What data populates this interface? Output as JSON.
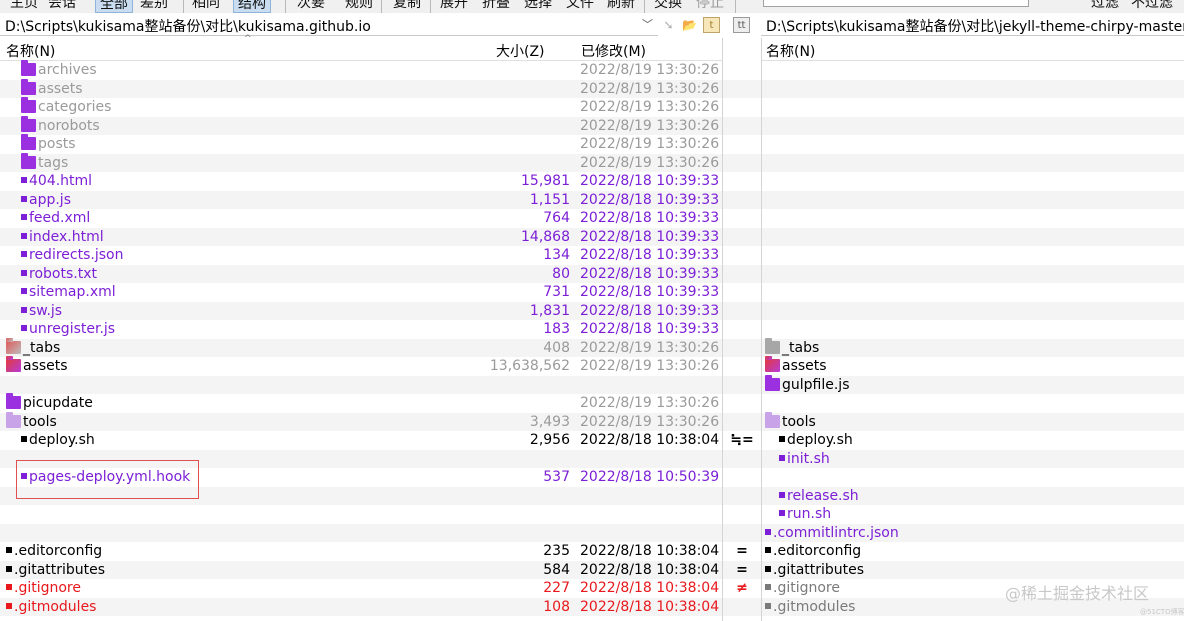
{
  "toolbar": {
    "items": [
      {
        "label": "主页",
        "state": "normal"
      },
      {
        "label": "会话",
        "state": "normal"
      },
      {
        "label": "全部",
        "state": "active"
      },
      {
        "label": "差别",
        "state": "normal"
      },
      {
        "label": "相同",
        "state": "normal"
      },
      {
        "label": "结构",
        "state": "active"
      },
      {
        "label": "次要",
        "state": "normal"
      },
      {
        "label": "规则",
        "state": "normal"
      },
      {
        "label": "复制",
        "state": "normal"
      },
      {
        "label": "展开",
        "state": "normal"
      },
      {
        "label": "折叠",
        "state": "normal"
      },
      {
        "label": "选择",
        "state": "normal"
      },
      {
        "label": "文件",
        "state": "normal"
      },
      {
        "label": "刷新",
        "state": "normal"
      },
      {
        "label": "交换",
        "state": "normal"
      },
      {
        "label": "停止",
        "state": "disabled"
      },
      {
        "label": "过滤",
        "state": "normal"
      },
      {
        "label": "不过滤",
        "state": "normal"
      }
    ]
  },
  "left_pane": {
    "path": "D:\\Scripts\\kukisama整站备份\\对比\\kukisama.github.io",
    "columns": {
      "name": "名称(N)",
      "size": "大小(Z)",
      "modified": "已修改(M)"
    }
  },
  "right_pane": {
    "path": "D:\\Scripts\\kukisama整站备份\\对比\\jekyll-theme-chirpy-master\\to",
    "columns": {
      "name": "名称(N)"
    }
  },
  "rows": [
    {
      "l_name": "archives",
      "l_icon": "folder-purple",
      "l_color": "gray",
      "l_indent": 1,
      "l_size": "",
      "l_date": "2022/8/19 13:30:26",
      "mid": "",
      "r_name": "",
      "r_icon": "",
      "r_color": ""
    },
    {
      "l_name": "assets",
      "l_icon": "folder-purple",
      "l_color": "gray",
      "l_indent": 1,
      "l_size": "",
      "l_date": "2022/8/19 13:30:26",
      "mid": "",
      "r_name": "",
      "r_icon": "",
      "r_color": ""
    },
    {
      "l_name": "categories",
      "l_icon": "folder-purple",
      "l_color": "gray",
      "l_indent": 1,
      "l_size": "",
      "l_date": "2022/8/19 13:30:26",
      "mid": "",
      "r_name": "",
      "r_icon": "",
      "r_color": ""
    },
    {
      "l_name": "norobots",
      "l_icon": "folder-purple",
      "l_color": "gray",
      "l_indent": 1,
      "l_size": "",
      "l_date": "2022/8/19 13:30:26",
      "mid": "",
      "r_name": "",
      "r_icon": "",
      "r_color": ""
    },
    {
      "l_name": "posts",
      "l_icon": "folder-purple",
      "l_color": "gray",
      "l_indent": 1,
      "l_size": "",
      "l_date": "2022/8/19 13:30:26",
      "mid": "",
      "r_name": "",
      "r_icon": "",
      "r_color": ""
    },
    {
      "l_name": "tags",
      "l_icon": "folder-purple",
      "l_color": "gray",
      "l_indent": 1,
      "l_size": "",
      "l_date": "2022/8/19 13:30:26",
      "mid": "",
      "r_name": "",
      "r_icon": "",
      "r_color": ""
    },
    {
      "l_name": "404.html",
      "l_icon": "file-purple",
      "l_color": "purple",
      "l_indent": 1,
      "l_size": "15,981",
      "l_date": "2022/8/18 10:39:33",
      "mid": "",
      "r_name": "",
      "r_icon": "",
      "r_color": ""
    },
    {
      "l_name": "app.js",
      "l_icon": "file-purple",
      "l_color": "purple",
      "l_indent": 1,
      "l_size": "1,151",
      "l_date": "2022/8/18 10:39:33",
      "mid": "",
      "r_name": "",
      "r_icon": "",
      "r_color": ""
    },
    {
      "l_name": "feed.xml",
      "l_icon": "file-purple",
      "l_color": "purple",
      "l_indent": 1,
      "l_size": "764",
      "l_date": "2022/8/18 10:39:33",
      "mid": "",
      "r_name": "",
      "r_icon": "",
      "r_color": ""
    },
    {
      "l_name": "index.html",
      "l_icon": "file-purple",
      "l_color": "purple",
      "l_indent": 1,
      "l_size": "14,868",
      "l_date": "2022/8/18 10:39:33",
      "mid": "",
      "r_name": "",
      "r_icon": "",
      "r_color": ""
    },
    {
      "l_name": "redirects.json",
      "l_icon": "file-purple",
      "l_color": "purple",
      "l_indent": 1,
      "l_size": "134",
      "l_date": "2022/8/18 10:39:33",
      "mid": "",
      "r_name": "",
      "r_icon": "",
      "r_color": ""
    },
    {
      "l_name": "robots.txt",
      "l_icon": "file-purple",
      "l_color": "purple",
      "l_indent": 1,
      "l_size": "80",
      "l_date": "2022/8/18 10:39:33",
      "mid": "",
      "r_name": "",
      "r_icon": "",
      "r_color": ""
    },
    {
      "l_name": "sitemap.xml",
      "l_icon": "file-purple",
      "l_color": "purple",
      "l_indent": 1,
      "l_size": "731",
      "l_date": "2022/8/18 10:39:33",
      "mid": "",
      "r_name": "",
      "r_icon": "",
      "r_color": ""
    },
    {
      "l_name": "sw.js",
      "l_icon": "file-purple",
      "l_color": "purple",
      "l_indent": 1,
      "l_size": "1,831",
      "l_date": "2022/8/18 10:39:33",
      "mid": "",
      "r_name": "",
      "r_icon": "",
      "r_color": ""
    },
    {
      "l_name": "unregister.js",
      "l_icon": "file-purple",
      "l_color": "purple",
      "l_indent": 1,
      "l_size": "183",
      "l_date": "2022/8/18 10:39:33",
      "mid": "",
      "r_name": "",
      "r_icon": "",
      "r_color": ""
    },
    {
      "l_name": "_tabs",
      "l_icon": "folder-redgray",
      "l_color": "black",
      "l_indent": 0,
      "l_size": "408",
      "l_size_gray": true,
      "l_date": "2022/8/19 13:30:26",
      "l_date_gray": true,
      "mid": "",
      "r_name": "_tabs",
      "r_icon": "folder-gray",
      "r_color": "black"
    },
    {
      "l_name": "assets",
      "l_icon": "folder-redpurple",
      "l_color": "black",
      "l_indent": 0,
      "l_size": "13,638,562",
      "l_size_gray": true,
      "l_date": "2022/8/19 13:30:26",
      "l_date_gray": true,
      "mid": "",
      "r_name": "assets",
      "r_icon": "folder-redpurple",
      "r_color": "black"
    },
    {
      "l_name": "",
      "l_icon": "",
      "l_color": "",
      "l_indent": 0,
      "l_size": "",
      "l_date": "",
      "mid": "",
      "r_name": "gulpfile.js",
      "r_icon": "folder-purple",
      "r_color": "black"
    },
    {
      "l_name": "picupdate",
      "l_icon": "folder-purple",
      "l_color": "black",
      "l_indent": 0,
      "l_size": "",
      "l_date": "2022/8/19 13:30:26",
      "l_date_gray": true,
      "mid": "",
      "r_name": "",
      "r_icon": "",
      "r_color": ""
    },
    {
      "l_name": "tools",
      "l_icon": "folder-pink",
      "l_color": "black",
      "l_indent": 0,
      "l_size": "3,493",
      "l_size_gray": true,
      "l_date": "2022/8/19 13:30:26",
      "l_date_gray": true,
      "mid": "",
      "r_name": "tools",
      "r_icon": "folder-pink",
      "r_color": "black"
    },
    {
      "l_name": "deploy.sh",
      "l_icon": "file-black",
      "l_color": "black",
      "l_indent": 1,
      "l_size": "2,956",
      "l_date": "2022/8/18 10:38:04",
      "mid": "≒=",
      "r_name": "deploy.sh",
      "r_icon": "file-black",
      "r_color": "black",
      "r_indent": 1
    },
    {
      "l_name": "",
      "l_icon": "",
      "l_color": "",
      "l_indent": 0,
      "l_size": "",
      "l_date": "",
      "mid": "",
      "r_name": "init.sh",
      "r_icon": "file-purple",
      "r_color": "purple",
      "r_indent": 1,
      "r_selected": true
    },
    {
      "l_name": "pages-deploy.yml.hook",
      "l_icon": "file-purple",
      "l_color": "purple",
      "l_indent": 1,
      "l_size": "537",
      "l_date": "2022/8/18 10:50:39",
      "mid": "",
      "r_name": "",
      "r_icon": "",
      "r_color": ""
    },
    {
      "l_name": "",
      "l_icon": "",
      "l_color": "",
      "l_indent": 0,
      "l_size": "",
      "l_date": "",
      "mid": "",
      "r_name": "release.sh",
      "r_icon": "file-purple",
      "r_color": "purple",
      "r_indent": 1
    },
    {
      "l_name": "",
      "l_icon": "",
      "l_color": "",
      "l_indent": 0,
      "l_size": "",
      "l_date": "",
      "mid": "",
      "r_name": "run.sh",
      "r_icon": "file-purple",
      "r_color": "purple",
      "r_indent": 1
    },
    {
      "l_name": "",
      "l_icon": "",
      "l_color": "",
      "l_indent": 0,
      "l_size": "",
      "l_date": "",
      "mid": "",
      "r_name": ".commitlintrc.json",
      "r_icon": "file-purple",
      "r_color": "purple",
      "r_indent": 0
    },
    {
      "l_name": ".editorconfig",
      "l_icon": "file-black",
      "l_color": "black",
      "l_indent": 0,
      "l_size": "235",
      "l_date": "2022/8/18 10:38:04",
      "mid": "=",
      "r_name": ".editorconfig",
      "r_icon": "file-black",
      "r_color": "black"
    },
    {
      "l_name": ".gitattributes",
      "l_icon": "file-black",
      "l_color": "black",
      "l_indent": 0,
      "l_size": "584",
      "l_date": "2022/8/18 10:38:04",
      "mid": "=",
      "r_name": ".gitattributes",
      "r_icon": "file-black",
      "r_color": "black"
    },
    {
      "l_name": ".gitignore",
      "l_icon": "file-red",
      "l_color": "red",
      "l_indent": 0,
      "l_size": "227",
      "l_date": "2022/8/18 10:38:04",
      "mid": "≠",
      "mid_red": true,
      "r_name": ".gitignore",
      "r_icon": "file-gray",
      "r_color": "gray2"
    },
    {
      "l_name": ".gitmodules",
      "l_icon": "file-red",
      "l_color": "red",
      "l_indent": 0,
      "l_size": "108",
      "l_date": "2022/8/18 10:38:04",
      "mid": "",
      "r_name": ".gitmodules",
      "r_icon": "file-gray",
      "r_color": "gray2"
    }
  ],
  "watermark": {
    "text": "@稀土掘金技术社区",
    "small": "@51CTO博客"
  }
}
